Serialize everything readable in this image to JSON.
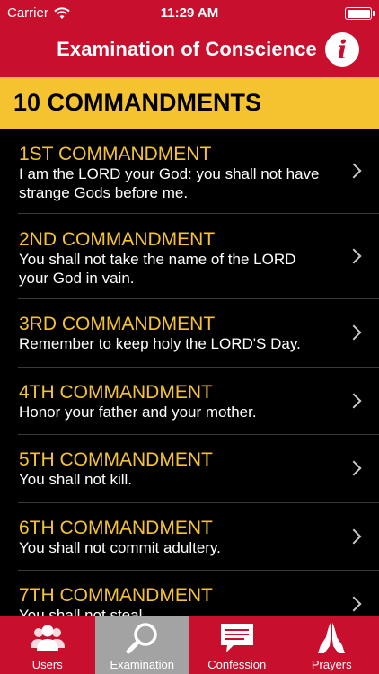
{
  "status_bar": {
    "carrier": "Carrier",
    "time": "11:29 AM"
  },
  "nav": {
    "title": "Examination of Conscience",
    "info_icon": "info-icon"
  },
  "section": {
    "title": "10 COMMANDMENTS"
  },
  "commandments": [
    {
      "title": "1ST COMMANDMENT",
      "desc": "I am the LORD your God: you shall not have strange Gods before me."
    },
    {
      "title": "2ND COMMANDMENT",
      "desc": "You shall not take the name of the LORD your God in vain."
    },
    {
      "title": "3RD COMMANDMENT",
      "desc": "Remember to keep holy the LORD'S Day."
    },
    {
      "title": "4TH COMMANDMENT",
      "desc": "Honor your father and your mother."
    },
    {
      "title": "5TH COMMANDMENT",
      "desc": "You shall not kill."
    },
    {
      "title": "6TH COMMANDMENT",
      "desc": "You shall not commit adultery."
    },
    {
      "title": "7TH COMMANDMENT",
      "desc": "You shall not steal."
    }
  ],
  "tabs": [
    {
      "label": "Users",
      "icon": "users-icon"
    },
    {
      "label": "Examination",
      "icon": "magnifier-icon",
      "active": true
    },
    {
      "label": "Confession",
      "icon": "speech-bubble-icon"
    },
    {
      "label": "Prayers",
      "icon": "praying-hands-icon"
    }
  ],
  "colors": {
    "brand_red": "#c8102e",
    "gold": "#f5c330",
    "active_tab": "#a3a3a3"
  }
}
